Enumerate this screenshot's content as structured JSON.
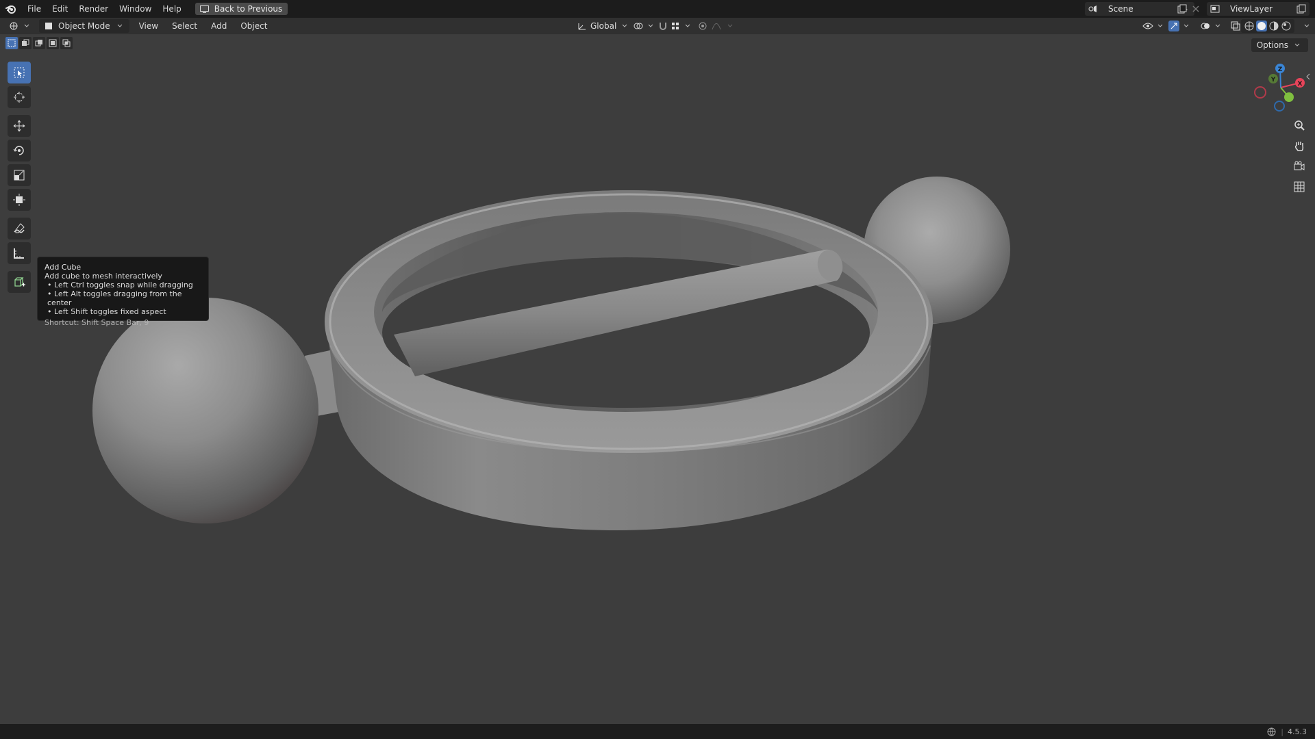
{
  "menu": [
    "File",
    "Edit",
    "Render",
    "Window",
    "Help"
  ],
  "back_button": "Back to Previous",
  "scene": "Scene",
  "view_layer": "ViewLayer",
  "header": {
    "mode": "Object Mode",
    "menus": [
      "View",
      "Select",
      "Add",
      "Object"
    ],
    "transform_orientation": "Global"
  },
  "options_label": "Options",
  "tooltip": {
    "title": "Add Cube",
    "description": "Add cube to mesh interactively",
    "bullets": [
      "Left Ctrl toggles snap while dragging",
      "Left Alt toggles dragging from the center",
      "Left Shift toggles fixed aspect"
    ],
    "shortcut": "Shortcut: Shift Space Bar, 9"
  },
  "gizmo": {
    "x": "X",
    "y": "Y",
    "z": "Z"
  },
  "status": {
    "version": "4.5.3"
  },
  "colors": {
    "accent": "#4772b3",
    "viewport_bg": "#3d3d3d",
    "axis_x": "#e8445a",
    "axis_y": "#7fbf3f",
    "axis_z": "#3a85d6"
  },
  "icons": [
    "blender-logo-icon",
    "select-box-icon",
    "cursor-icon",
    "move-icon",
    "rotate-icon",
    "scale-icon",
    "transform-icon",
    "annotate-icon",
    "measure-icon",
    "add-cube-icon",
    "zoom-icon",
    "hand-icon",
    "camera-icon",
    "grid-icon"
  ]
}
